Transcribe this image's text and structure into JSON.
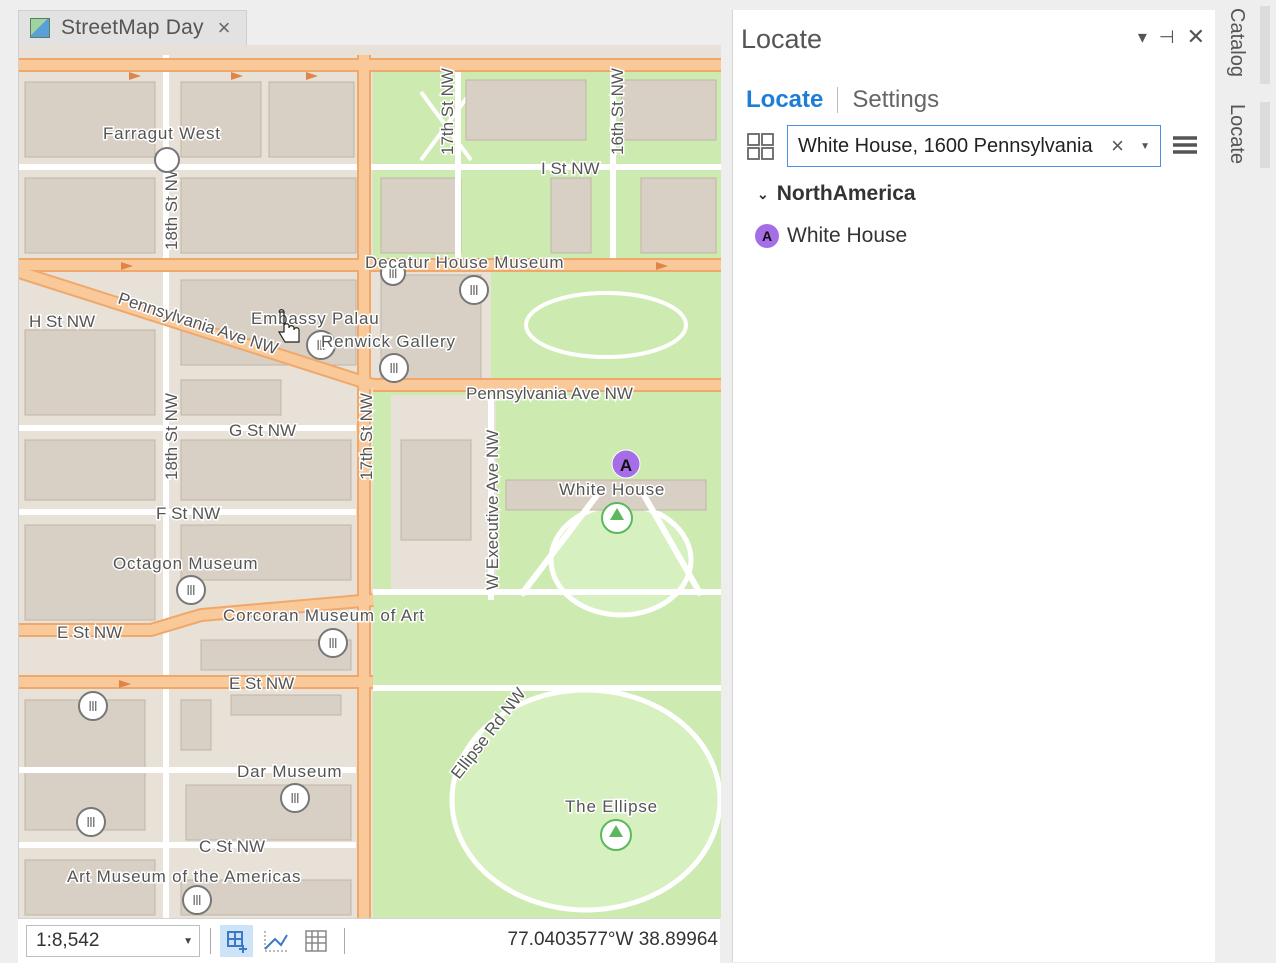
{
  "map_tab": {
    "title": "StreetMap Day",
    "close_icon": "×"
  },
  "map": {
    "street_labels": [
      "I St NW",
      "H St NW",
      "G St NW",
      "F St NW",
      "E St NW",
      "E St NW",
      "C St NW",
      "18th St NW",
      "18th St NW",
      "17th St NW",
      "17th St NW",
      "16th St NW",
      "Pennsylvania Ave NW",
      "Pennsylvania Ave NW",
      "W Executive Ave NW",
      "Ellipse Rd NW"
    ],
    "poi_labels": [
      "Farragut West",
      "Decatur House Museum",
      "Embassy Palau",
      "Renwick Gallery",
      "White House",
      "Octagon Museum",
      "Corcoran Museum of Art",
      "Dar Museum",
      "The Ellipse",
      "Art Museum of the Americas"
    ],
    "marker_label": "A",
    "colors": {
      "park": "#cdebb0",
      "road": "#fac99a",
      "road_edge": "#f0a86a",
      "building": "#d8d0c4",
      "block": "#e7e1d7",
      "marker": "#a66ee6"
    }
  },
  "status_bar": {
    "scale": "1:8,542",
    "coordinates": "77.0403577°W 38.89964"
  },
  "locate_pane": {
    "title": "Locate",
    "tabs": [
      "Locate",
      "Settings"
    ],
    "search_value": "White House, 1600 Pennsylvania",
    "clear_icon": "×",
    "group_label": "NorthAmerica",
    "results": [
      {
        "marker": "A",
        "label": "White House"
      }
    ]
  },
  "side_tabs": [
    "Catalog",
    "Locate"
  ]
}
